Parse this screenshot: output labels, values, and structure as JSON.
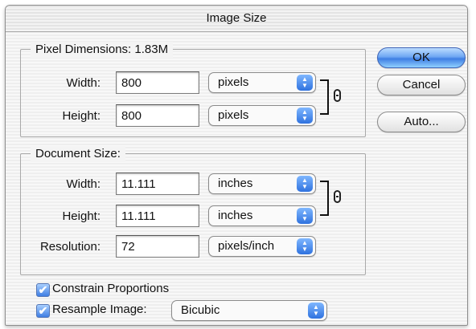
{
  "window": {
    "title": "Image Size"
  },
  "pixel_dimensions": {
    "legend": "Pixel Dimensions:  1.83M",
    "width_label": "Width:",
    "width_value": "800",
    "width_unit": "pixels",
    "height_label": "Height:",
    "height_value": "800",
    "height_unit": "pixels"
  },
  "document_size": {
    "legend": "Document Size:",
    "width_label": "Width:",
    "width_value": "11.111",
    "width_unit": "inches",
    "height_label": "Height:",
    "height_value": "11.111",
    "height_unit": "inches",
    "resolution_label": "Resolution:",
    "resolution_value": "72",
    "resolution_unit": "pixels/inch"
  },
  "options": {
    "constrain_label": "Constrain Proportions",
    "constrain_checked": true,
    "resample_label": "Resample Image:",
    "resample_checked": true,
    "resample_method": "Bicubic"
  },
  "buttons": {
    "ok": "OK",
    "cancel": "Cancel",
    "auto": "Auto..."
  },
  "icons": {
    "checkmark": "✔",
    "link": "chain-link-icon",
    "popup_arrows": "up-down-arrows-icon"
  },
  "colors": {
    "accent": "#3f7ee3",
    "default_button": "#6ea7f3"
  }
}
